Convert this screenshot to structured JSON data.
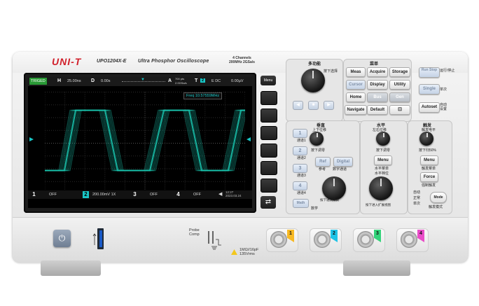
{
  "header": {
    "brand": "UNI-T",
    "model": "UPO1204X-E",
    "subtitle": "Ultra Phosphor Oscilloscope",
    "channels_line1": "4 Channels",
    "channels_line2": "200MHz 2GSa/s"
  },
  "screen": {
    "status": {
      "trigger_state": "TRIGED",
      "timebase_label": "H",
      "timebase_value": "25.00ns",
      "delay_label": "D",
      "delay_value": "0.00s",
      "memory_top": "700 pts",
      "memory_bottom": "2.0GSa/s",
      "trigger_label": "T",
      "trigger_source": "2",
      "trigger_coupling": "E DC",
      "trigger_level": "0.00µV"
    },
    "freq_readout": "Freq  10.57559MHz",
    "channels": [
      {
        "num": "1",
        "value": "OFF",
        "color": "#f4c21b"
      },
      {
        "num": "2",
        "value": "200.00mV 1X",
        "color": "#19c7c7"
      },
      {
        "num": "3",
        "value": "OFF",
        "color": "#d44fd4"
      },
      {
        "num": "4",
        "value": "OFF",
        "color": "#3da7e8"
      }
    ],
    "clock": "12:27",
    "date": "2023.03.24",
    "waveform_color": "#19c7b0"
  },
  "menu": {
    "menu_key": "Menu",
    "swap_key": "⇄"
  },
  "multipurpose": {
    "title": "多功能",
    "push_select": "按下选择"
  },
  "menu_section": {
    "title": "菜单",
    "keys": [
      "Meas",
      "Acquire",
      "Storage",
      "Cursor",
      "Display",
      "Utility",
      "Home",
      "Bus",
      "Gen",
      "Navigate",
      "Default",
      "PrtSc"
    ]
  },
  "run_section": {
    "keys": [
      "Run Stop",
      "Single",
      "Autoset"
    ],
    "labels": [
      "运行/停止",
      "单次",
      "自动设置"
    ]
  },
  "vertical": {
    "title": "垂直",
    "updown": "上下位移",
    "channel_labels": [
      "通道1",
      "通道2",
      "通道3",
      "通道4"
    ],
    "ref_key": "Ref",
    "ref_label": "参考",
    "digital_key": "Digital",
    "digital_label": "数字通道",
    "push_zero": "按下调零",
    "push_zero2": "按下调零",
    "volts_label": "电压档位",
    "fine_label": "按下进入细调",
    "math_key": "Math",
    "math_label": "数学"
  },
  "horizontal": {
    "title": "水平",
    "leftright": "左右位移",
    "push_zero": "按下调零",
    "menu_key": "Menu",
    "hmenu_label": "水平菜单",
    "scale_label": "水平档位",
    "zoom_label": "按下进入扩展视图"
  },
  "trigger": {
    "title": "触发",
    "level_label": "触发电平",
    "push_50": "按下归50%",
    "menu_key": "Menu",
    "menu_label": "触发菜单",
    "force_key": "Force",
    "force_label": "强制触发",
    "mode_key": "Mode",
    "mode_auto": "自动",
    "mode_normal": "正常",
    "mode_single": "单次",
    "mode_label": "触发模式"
  },
  "front": {
    "power_icon": "⏻",
    "probe_comp": "Probe Comp",
    "input_spec_line1": "1MΩ//16pF",
    "input_spec_line2": "135Vrms",
    "bnc_tags": [
      "1",
      "2",
      "3",
      "4"
    ],
    "bnc_colors": [
      "#f7b924",
      "#1fc3e6",
      "#34d37a",
      "#e94dc8"
    ]
  }
}
